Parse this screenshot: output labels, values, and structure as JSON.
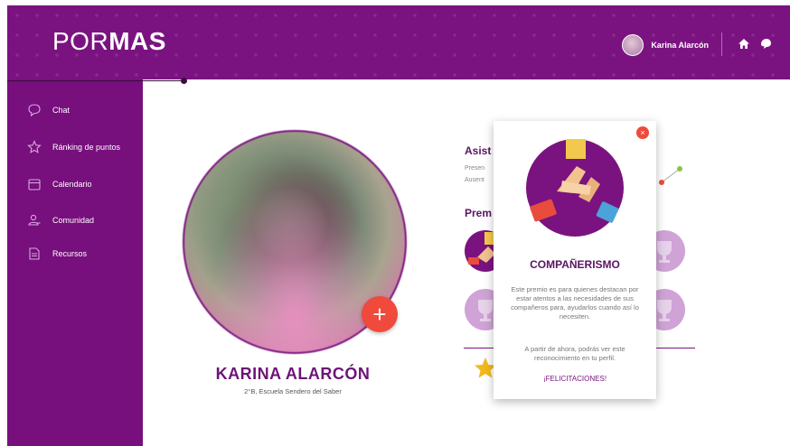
{
  "app": {
    "logo_light": "POR",
    "logo_bold": "MAS"
  },
  "header": {
    "user_name": "Karina Alarcón"
  },
  "sidebar": {
    "items": [
      {
        "label": "Chat",
        "icon": "chat-bubble-icon"
      },
      {
        "label": "Ránking de puntos",
        "icon": "star-icon"
      },
      {
        "label": "Calendario",
        "icon": "calendar-icon"
      },
      {
        "label": "Comunidad",
        "icon": "people-icon"
      },
      {
        "label": "Recursos",
        "icon": "document-icon"
      }
    ]
  },
  "profile": {
    "name": "KARINA ALARCÓN",
    "school": "2°B, Escuela Sendero del Saber"
  },
  "attendance": {
    "title": "Asist",
    "line1": "Presen",
    "line2": "Ausent"
  },
  "prizes": {
    "title": "Prem"
  },
  "modal": {
    "title": "COMPAÑERISMO",
    "desc": "Este premio es para quienes destacan por estar atentos a las necesidades de sus compañeros para, ayudarlos cuando así lo necesiten.",
    "note": "A partir de ahora, podrás ver este reconocimiento en tu perfil.",
    "link": "¡FELICITACIONES!"
  },
  "colors": {
    "brand_purple": "#7a1380",
    "accent_red": "#ef4a3c",
    "badge_lilac": "#cfa3d6"
  }
}
